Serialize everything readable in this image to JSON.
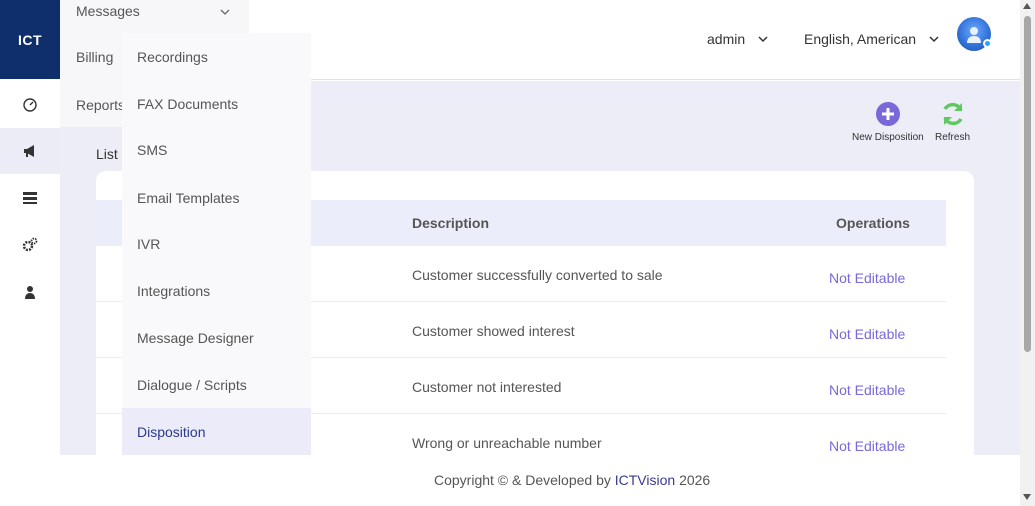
{
  "logo": "ICT",
  "header": {
    "user": "admin",
    "language": "English, American"
  },
  "sidebar_icons": [
    "dashboard-icon",
    "megaphone-icon",
    "list-icon",
    "settings-icon",
    "user-icon"
  ],
  "menu": {
    "messages": "Messages",
    "billing": "Billing",
    "reports": "Reports"
  },
  "submenu": [
    {
      "label": "Recordings"
    },
    {
      "label": "FAX Documents"
    },
    {
      "label": "SMS"
    },
    {
      "label": "Email Templates"
    },
    {
      "label": "IVR"
    },
    {
      "label": "Integrations"
    },
    {
      "label": "Message Designer"
    },
    {
      "label": "Dialogue / Scripts"
    },
    {
      "label": "Disposition",
      "active": true
    }
  ],
  "toolbar": {
    "new_disposition": "New Disposition",
    "refresh": "Refresh"
  },
  "list_label": "List",
  "table": {
    "headers": {
      "description": "Description",
      "operations": "Operations"
    },
    "rows": [
      {
        "description": "Customer successfully converted to sale",
        "operation": "Not Editable"
      },
      {
        "description": "Customer showed interest",
        "operation": "Not Editable"
      },
      {
        "description": "Customer not interested",
        "operation": "Not Editable"
      },
      {
        "description": "Wrong or unreachable number",
        "operation": "Not Editable"
      }
    ]
  },
  "footer": {
    "prefix": "Copyright © & Developed by ",
    "brand": "ICTVision",
    "year": " 2026"
  },
  "colors": {
    "brand_navy": "#0e2f6b",
    "accent_purple": "#7b68d8",
    "refresh_green": "#5ec95e"
  }
}
